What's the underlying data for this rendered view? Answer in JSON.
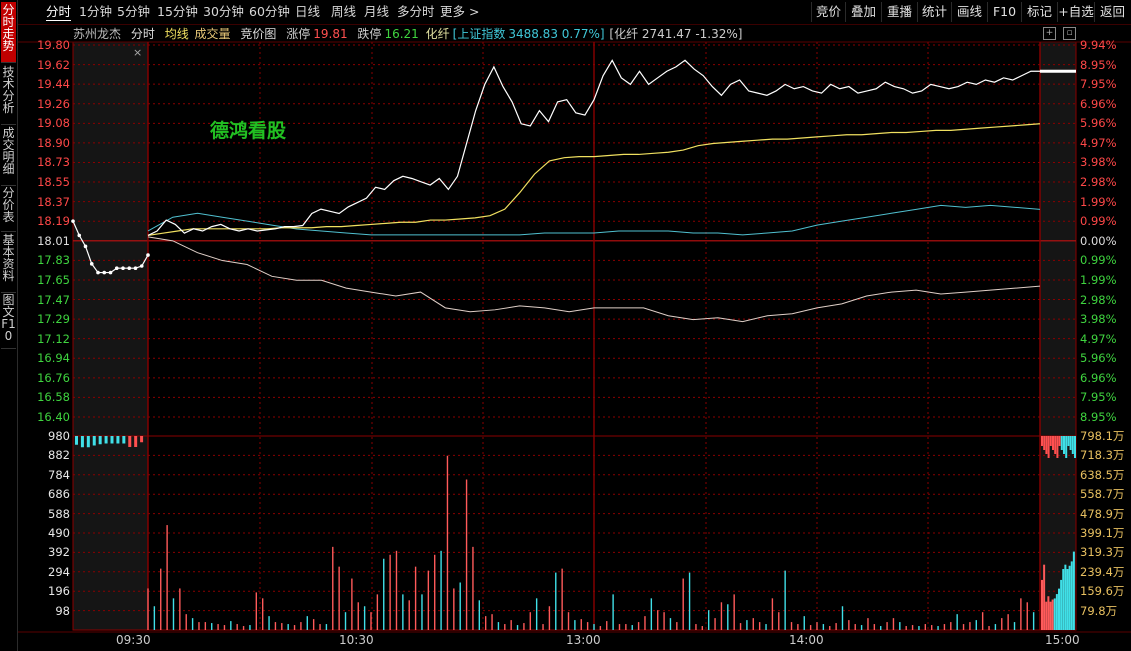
{
  "toolbar": {
    "tabs": [
      "分时",
      "1分钟",
      "5分钟",
      "15分钟",
      "30分钟",
      "60分钟",
      "日线",
      "周线",
      "月线",
      "多分时",
      "更多 >"
    ],
    "right_buttons": [
      "竞价",
      "叠加",
      "重播",
      "统计",
      "画线",
      "F10",
      "标记",
      "+自选",
      "返回"
    ]
  },
  "sidebar": {
    "tabs": [
      "分时走势",
      "技术分析",
      "成交明细",
      "分价表",
      "基本资料",
      "图文F10"
    ]
  },
  "info": {
    "stock_name": "苏州龙杰",
    "mode": "分时",
    "avg_line": "均线",
    "volume": "成交量",
    "auction_chart": "竞价图",
    "limit_up_label": "涨停",
    "limit_up_value": "19.81",
    "limit_down_label": "跌停",
    "limit_down_value": "16.21",
    "sector": "化纤",
    "index_label": "[上证指数",
    "index_value": "3488.83 0.77%]",
    "sector_info": "[化纤 2741.47 -1.32%]"
  },
  "watermark": "德鸿看股",
  "colors": {
    "up": "#ff4040",
    "down": "#3fd43f",
    "grid": "#8a0000",
    "price": "#ffffff",
    "avg": "#f0e060",
    "index": "#50c0d0",
    "sector": "#e0d0c8",
    "vol_up": "#ff5a5a",
    "vol_down": "#40e0e8"
  },
  "chart_data": {
    "type": "line",
    "title": "",
    "price_ticks": [
      "19.80",
      "19.62",
      "19.44",
      "19.26",
      "19.08",
      "18.90",
      "18.73",
      "18.55",
      "18.37",
      "18.19",
      "18.01",
      "17.83",
      "17.65",
      "17.47",
      "17.29",
      "17.12",
      "16.94",
      "16.76",
      "16.58",
      "16.40"
    ],
    "pct_ticks": [
      "9.94%",
      "8.95%",
      "7.95%",
      "6.96%",
      "5.96%",
      "4.97%",
      "3.98%",
      "2.98%",
      "1.99%",
      "0.99%",
      "0.00%",
      "0.99%",
      "1.99%",
      "2.98%",
      "3.98%",
      "4.97%",
      "5.96%",
      "6.96%",
      "7.95%",
      "8.95%"
    ],
    "prev_close": 18.01,
    "ylim": [
      16.4,
      19.8
    ],
    "vol_ticks_left": [
      "980",
      "882",
      "784",
      "686",
      "588",
      "490",
      "392",
      "294",
      "196",
      "98"
    ],
    "vol_ticks_right": [
      "798.1万",
      "718.3万",
      "638.5万",
      "558.7万",
      "478.9万",
      "399.1万",
      "319.3万",
      "239.4万",
      "159.6万",
      "79.8万"
    ],
    "time_labels": [
      "09:30",
      "10:30",
      "13:00",
      "14:00",
      "15:00"
    ],
    "auction_price": [
      18.19,
      18.06,
      17.96,
      17.8,
      17.72,
      17.72,
      17.72,
      17.76,
      17.76,
      17.76,
      17.76,
      17.78,
      17.88
    ],
    "price": [
      18.06,
      18.1,
      18.2,
      18.16,
      18.08,
      18.12,
      18.1,
      18.14,
      18.16,
      18.12,
      18.1,
      18.12,
      18.1,
      18.11,
      18.12,
      18.14,
      18.14,
      18.15,
      18.26,
      18.3,
      18.28,
      18.26,
      18.32,
      18.36,
      18.4,
      18.5,
      18.48,
      18.56,
      18.6,
      18.58,
      18.55,
      18.52,
      18.58,
      18.48,
      18.6,
      18.9,
      19.2,
      19.44,
      19.6,
      19.42,
      19.28,
      19.08,
      19.06,
      19.2,
      19.1,
      19.28,
      19.3,
      19.18,
      19.16,
      19.3,
      19.52,
      19.66,
      19.5,
      19.44,
      19.56,
      19.44,
      19.5,
      19.56,
      19.6,
      19.66,
      19.58,
      19.52,
      19.42,
      19.34,
      19.44,
      19.48,
      19.38,
      19.36,
      19.34,
      19.38,
      19.44,
      19.4,
      19.42,
      19.38,
      19.36,
      19.44,
      19.4,
      19.42,
      19.36,
      19.38,
      19.4,
      19.46,
      19.42,
      19.4,
      19.36,
      19.38,
      19.44,
      19.42,
      19.4,
      19.42,
      19.46,
      19.44,
      19.48,
      19.46,
      19.5,
      19.48,
      19.52,
      19.56,
      19.56
    ],
    "avg": [
      18.06,
      18.08,
      18.1,
      18.12,
      18.12,
      18.12,
      18.12,
      18.12,
      18.12,
      18.13,
      18.13,
      18.13,
      18.14,
      18.14,
      18.15,
      18.16,
      18.17,
      18.18,
      18.18,
      18.2,
      18.2,
      18.21,
      18.22,
      18.24,
      18.3,
      18.45,
      18.62,
      18.74,
      18.77,
      18.78,
      18.78,
      18.79,
      18.8,
      18.8,
      18.81,
      18.82,
      18.84,
      18.88,
      18.9,
      18.91,
      18.92,
      18.93,
      18.94,
      18.94,
      18.95,
      18.96,
      18.97,
      18.98,
      18.98,
      18.99,
      19.0,
      19.0,
      19.01,
      19.02,
      19.02,
      19.03,
      19.04,
      19.05,
      19.06,
      19.07,
      19.08
    ],
    "index_line": [
      0.05,
      0.12,
      0.14,
      0.12,
      0.1,
      0.08,
      0.06,
      0.05,
      0.04,
      0.03,
      0.03,
      0.03,
      0.03,
      0.03,
      0.03,
      0.03,
      0.04,
      0.04,
      0.04,
      0.05,
      0.05,
      0.05,
      0.04,
      0.04,
      0.03,
      0.04,
      0.05,
      0.08,
      0.1,
      0.12,
      0.14,
      0.16,
      0.18,
      0.17,
      0.18,
      0.17,
      0.16
    ],
    "sector_line": [
      0.02,
      0.0,
      -0.06,
      -0.1,
      -0.12,
      -0.18,
      -0.2,
      -0.2,
      -0.24,
      -0.26,
      -0.28,
      -0.26,
      -0.34,
      -0.36,
      -0.35,
      -0.33,
      -0.34,
      -0.36,
      -0.34,
      -0.34,
      -0.34,
      -0.38,
      -0.4,
      -0.39,
      -0.41,
      -0.38,
      -0.37,
      -0.34,
      -0.32,
      -0.28,
      -0.26,
      -0.25,
      -0.27,
      -0.26,
      -0.25,
      -0.24,
      -0.23
    ],
    "volume_auction": [
      35,
      45,
      45,
      38,
      33,
      30,
      30,
      30,
      30,
      44,
      44,
      25
    ],
    "volume_main": [
      210,
      120,
      310,
      530,
      160,
      210,
      80,
      60,
      40,
      40,
      35,
      30,
      25,
      45,
      30,
      20,
      25,
      190,
      160,
      70,
      40,
      35,
      30,
      25,
      40,
      70,
      55,
      30,
      30,
      420,
      320,
      90,
      260,
      140,
      120,
      90,
      180,
      360,
      380,
      400,
      180,
      150,
      320,
      180,
      300,
      380,
      400,
      880,
      210,
      240,
      760,
      420,
      150,
      70,
      80,
      40,
      30,
      50,
      25,
      35,
      90,
      160,
      30,
      120,
      290,
      310,
      90,
      50,
      55,
      40,
      30,
      20,
      45,
      180,
      30,
      30,
      25,
      40,
      70,
      160,
      100,
      90,
      60,
      40,
      260,
      290,
      30,
      20,
      100,
      60,
      140,
      130,
      180,
      35,
      50,
      60,
      40,
      30,
      160,
      90,
      300,
      40,
      30,
      70,
      25,
      40,
      30,
      20,
      35,
      120,
      50,
      30,
      25,
      60,
      30,
      20,
      40,
      60,
      40,
      20,
      25,
      20,
      30,
      25,
      20,
      30,
      40,
      80,
      30,
      40,
      50,
      90,
      20,
      30,
      60,
      80,
      40,
      160,
      140,
      90
    ],
    "volume_close": [
      460,
      600,
      260,
      310,
      260,
      280,
      290,
      330,
      380,
      460,
      560,
      600,
      560,
      590,
      630,
      720
    ]
  }
}
